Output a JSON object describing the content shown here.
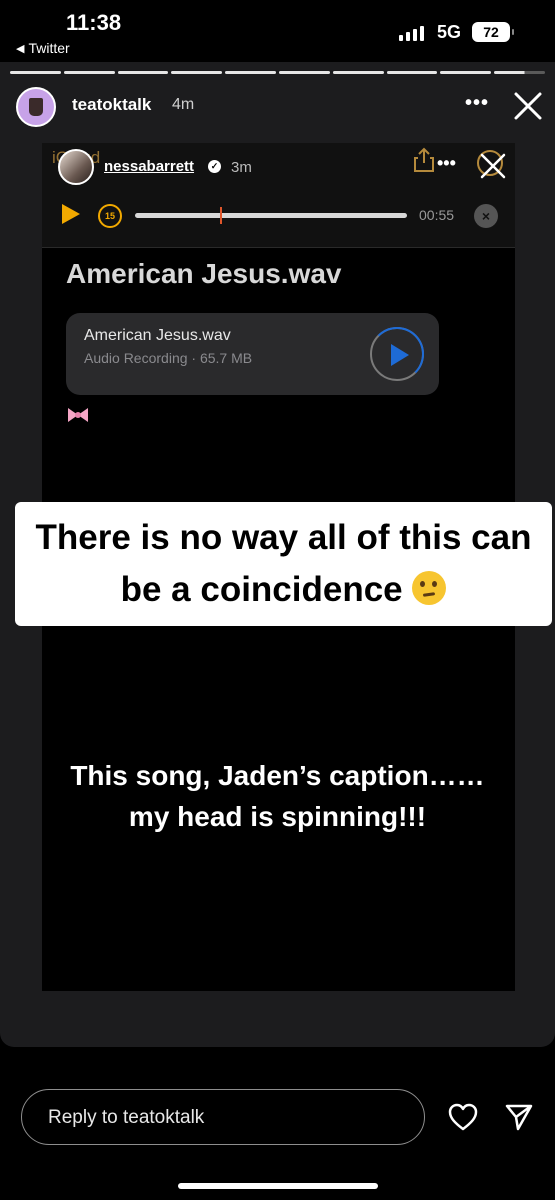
{
  "status_bar": {
    "time": "11:38",
    "back_app": "Twitter",
    "network": "5G",
    "battery": "72"
  },
  "story": {
    "username": "teatoktalk",
    "time_ago": "4m",
    "more_icon": "more-horizontal-icon",
    "close_icon": "close-icon"
  },
  "embedded_screenshot": {
    "app_label": "iCloud",
    "username": "nessabarrett",
    "time_ago": "3m",
    "duration": "00:55",
    "note_title": "American Jesus.wav",
    "attachment": {
      "name": "American Jesus.wav",
      "meta": "Audio Recording · 65.7 MB"
    }
  },
  "caption": {
    "text": "There is no way all of this can be a coincidence"
  },
  "overlay": {
    "line1": "This song, Jaden’s caption……",
    "line2": "my head is spinning!!!"
  },
  "reply": {
    "placeholder": "Reply to teatoktalk"
  },
  "colors": {
    "accent_orange": "#f2a900",
    "accent_blue": "#1e6bd6",
    "card_bg": "#1c1c1e"
  }
}
